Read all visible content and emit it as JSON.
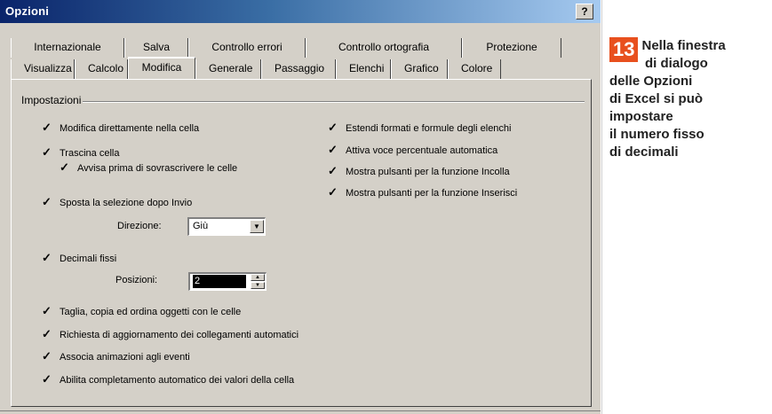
{
  "dialog": {
    "title": "Opzioni",
    "help_button": "?",
    "tabs_back": [
      "Internazionale",
      "Salva",
      "Controllo errori",
      "Controllo ortografia",
      "Protezione"
    ],
    "tabs_front": [
      "Visualizza",
      "Calcolo",
      "Modifica",
      "Generale",
      "Passaggio",
      "Elenchi",
      "Grafico",
      "Colore"
    ],
    "active_tab": "Modifica",
    "group_title": "Impostazioni",
    "left_options": {
      "modifica_cella": "Modifica direttamente nella cella",
      "trascina_cella": "Trascina cella",
      "avvisa": "Avvisa prima di sovrascrivere le celle",
      "sposta": "Sposta la selezione dopo Invio",
      "direzione_label": "Direzione:",
      "direzione_value": "Giù",
      "decimali": "Decimali fissi",
      "posizioni_label": "Posizioni:",
      "posizioni_value": "2",
      "taglia": "Taglia, copia ed ordina oggetti con le celle",
      "richiesta": "Richiesta di aggiornamento dei collegamenti automatici",
      "associa": "Associa animazioni agli eventi",
      "abilita": "Abilita completamento automatico dei valori della cella"
    },
    "right_options": {
      "estendi": "Estendi formati e formule degli elenchi",
      "attiva": "Attiva voce percentuale automatica",
      "mostra_incolla": "Mostra pulsanti per la funzione Incolla",
      "mostra_inserisci": "Mostra pulsanti per la funzione Inserisci"
    },
    "checkbox_glyph": "✓"
  },
  "caption": {
    "number": "13",
    "lines": [
      "Nella finestra",
      "di dialogo",
      "delle Opzioni",
      "di Excel si può",
      "impostare",
      "il numero fisso",
      "di decimali"
    ]
  },
  "colors": {
    "badge": "#e8501e",
    "title_bar": "#0a246a",
    "dialog_bg": "#d4d0c8"
  }
}
